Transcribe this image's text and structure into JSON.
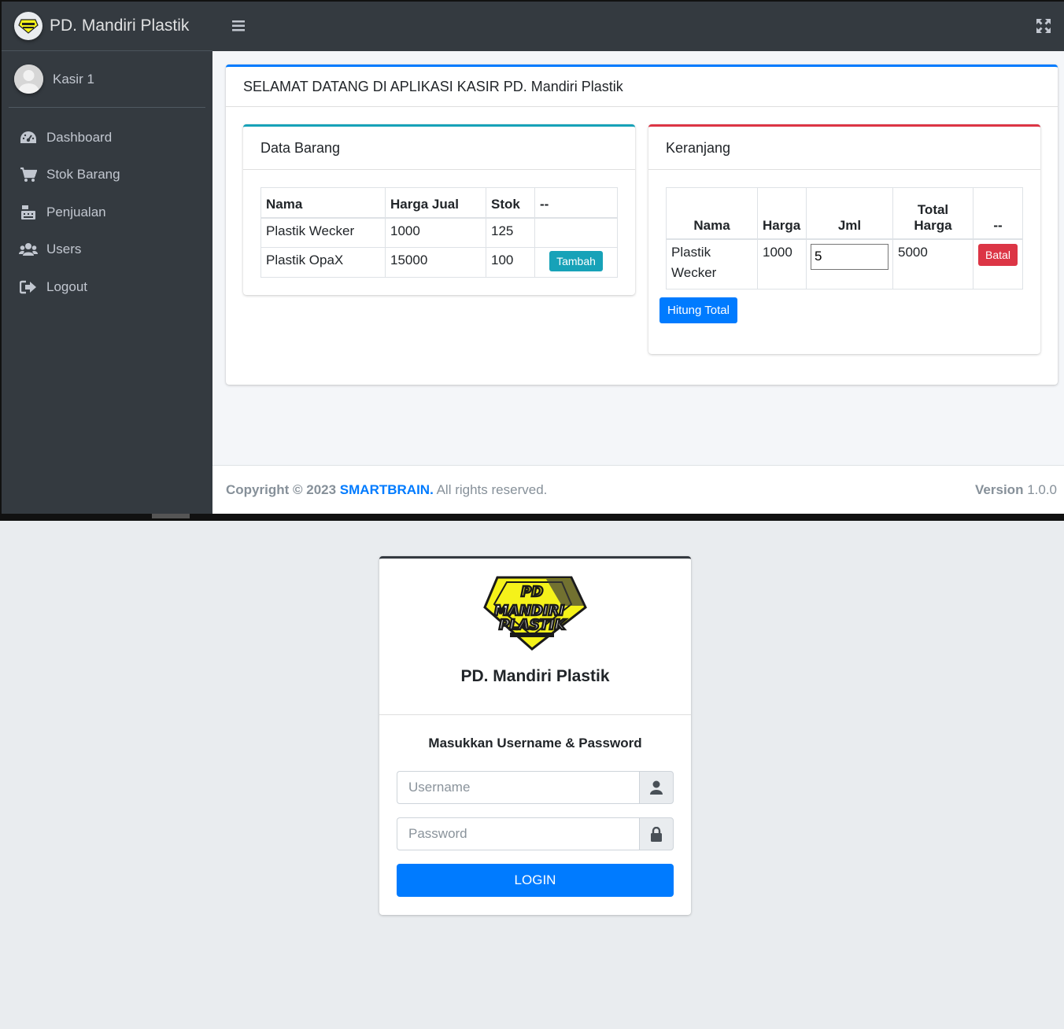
{
  "app": {
    "brand_name": "PD. Mandiri Plastik",
    "user": "Kasir 1",
    "nav": [
      {
        "label": "Dashboard",
        "icon": "dashboard-icon"
      },
      {
        "label": "Stok Barang",
        "icon": "cart-icon"
      },
      {
        "label": "Penjualan",
        "icon": "cash-register-icon"
      },
      {
        "label": "Users",
        "icon": "users-icon"
      },
      {
        "label": "Logout",
        "icon": "logout-icon"
      }
    ],
    "welcome_title": "SELAMAT DATANG DI APLIKASI KASIR PD. Mandiri Plastik",
    "data_barang": {
      "title": "Data Barang",
      "headers": [
        "Nama",
        "Harga Jual",
        "Stok",
        "--"
      ],
      "rows": [
        {
          "nama": "Plastik Wecker",
          "harga": "1000",
          "stok": "125",
          "action": ""
        },
        {
          "nama": "Plastik OpaX",
          "harga": "15000",
          "stok": "100",
          "action": "Tambah"
        }
      ]
    },
    "keranjang": {
      "title": "Keranjang",
      "headers": [
        "Nama",
        "Harga",
        "Jml",
        "Total Harga",
        "--"
      ],
      "rows": [
        {
          "nama": "Plastik Wecker",
          "harga": "1000",
          "jml": "5",
          "total": "5000",
          "action": "Batal"
        }
      ],
      "hitung_label": "Hitung Total"
    },
    "footer": {
      "copyright_prefix": "Copyright © 2023",
      "company": "SMARTBRAIN.",
      "rights": "All rights reserved.",
      "version_label": "Version",
      "version": "1.0.0"
    }
  },
  "login": {
    "logo_text_1": "PD",
    "logo_text_2": "MANDIRI",
    "logo_text_3": "PLASTIK",
    "title": "PD. Mandiri Plastik",
    "message": "Masukkan Username & Password",
    "username_placeholder": "Username",
    "password_placeholder": "Password",
    "button": "LOGIN"
  },
  "colors": {
    "primary": "#007bff",
    "info": "#17a2b8",
    "danger": "#dc3545",
    "sidebar": "#343a40",
    "logo_yellow": "#f5f21a"
  }
}
